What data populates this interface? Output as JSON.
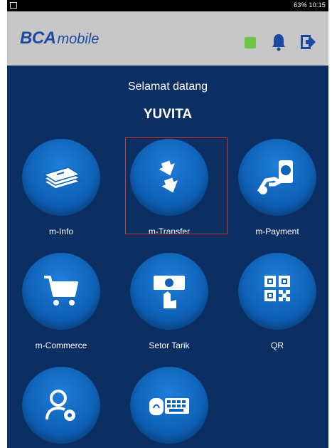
{
  "status_bar": {
    "right_text": "63% 10:15"
  },
  "app_bar": {
    "brand_bold": "BCA",
    "brand_light": "mobile"
  },
  "welcome": {
    "greeting": "Selamat datang",
    "user_name": "YUVITA"
  },
  "menu": [
    {
      "label": "m-Info",
      "icon": "banknotes-icon"
    },
    {
      "label": "m-Transfer",
      "icon": "transfer-arrows-icon"
    },
    {
      "label": "m-Payment",
      "icon": "payment-hand-icon"
    },
    {
      "label": "m-Commerce",
      "icon": "cart-icon"
    },
    {
      "label": "Setor Tarik",
      "icon": "cash-deposit-icon"
    },
    {
      "label": "QR",
      "icon": "qr-code-icon"
    },
    {
      "label": "",
      "icon": "user-settings-icon"
    },
    {
      "label": "",
      "icon": "keyboard-icon"
    }
  ],
  "colors": {
    "background": "#0b2e63",
    "app_bar": "#c7c7c7",
    "brand": "#1a4aa3",
    "tile": "#0f62b8",
    "indicator": "#6cc644",
    "selection": "#d9362b"
  }
}
